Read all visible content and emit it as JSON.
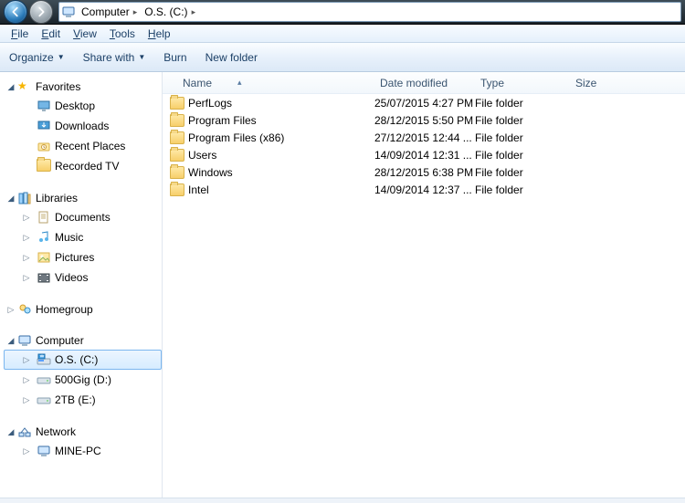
{
  "address": {
    "segments": [
      {
        "label": "Computer"
      },
      {
        "label": "O.S. (C:)"
      }
    ]
  },
  "menu": {
    "file": {
      "u": "F",
      "rest": "ile"
    },
    "edit": {
      "u": "E",
      "rest": "dit"
    },
    "view": {
      "u": "V",
      "rest": "iew"
    },
    "tools": {
      "u": "T",
      "rest": "ools"
    },
    "help": {
      "u": "H",
      "rest": "elp"
    }
  },
  "toolbar": {
    "organize": "Organize",
    "sharewith": "Share with",
    "burn": "Burn",
    "newfolder": "New folder"
  },
  "columns": {
    "name": "Name",
    "date": "Date modified",
    "type": "Type",
    "size": "Size"
  },
  "nav": {
    "favorites": {
      "label": "Favorites",
      "items": [
        {
          "label": "Desktop",
          "icon": "desktop"
        },
        {
          "label": "Downloads",
          "icon": "downloads"
        },
        {
          "label": "Recent Places",
          "icon": "recent"
        },
        {
          "label": "Recorded TV",
          "icon": "folder"
        }
      ]
    },
    "libraries": {
      "label": "Libraries",
      "items": [
        {
          "label": "Documents",
          "icon": "doc"
        },
        {
          "label": "Music",
          "icon": "music"
        },
        {
          "label": "Pictures",
          "icon": "pic"
        },
        {
          "label": "Videos",
          "icon": "vid"
        }
      ]
    },
    "homegroup": {
      "label": "Homegroup"
    },
    "computer": {
      "label": "Computer",
      "items": [
        {
          "label": "O.S. (C:)",
          "icon": "osdrive",
          "selected": true
        },
        {
          "label": "500Gig (D:)",
          "icon": "drive"
        },
        {
          "label": "2TB (E:)",
          "icon": "drive"
        }
      ]
    },
    "network": {
      "label": "Network",
      "items": [
        {
          "label": "MINE-PC",
          "icon": "pc"
        }
      ]
    }
  },
  "files": [
    {
      "name": "PerfLogs",
      "date": "25/07/2015 4:27 PM",
      "type": "File folder",
      "size": ""
    },
    {
      "name": "Program Files",
      "date": "28/12/2015 5:50 PM",
      "type": "File folder",
      "size": ""
    },
    {
      "name": "Program Files (x86)",
      "date": "27/12/2015 12:44 ...",
      "type": "File folder",
      "size": ""
    },
    {
      "name": "Users",
      "date": "14/09/2014 12:31 ...",
      "type": "File folder",
      "size": ""
    },
    {
      "name": "Windows",
      "date": "28/12/2015 6:38 PM",
      "type": "File folder",
      "size": ""
    },
    {
      "name": "Intel",
      "date": "14/09/2014 12:37 ...",
      "type": "File folder",
      "size": ""
    }
  ]
}
